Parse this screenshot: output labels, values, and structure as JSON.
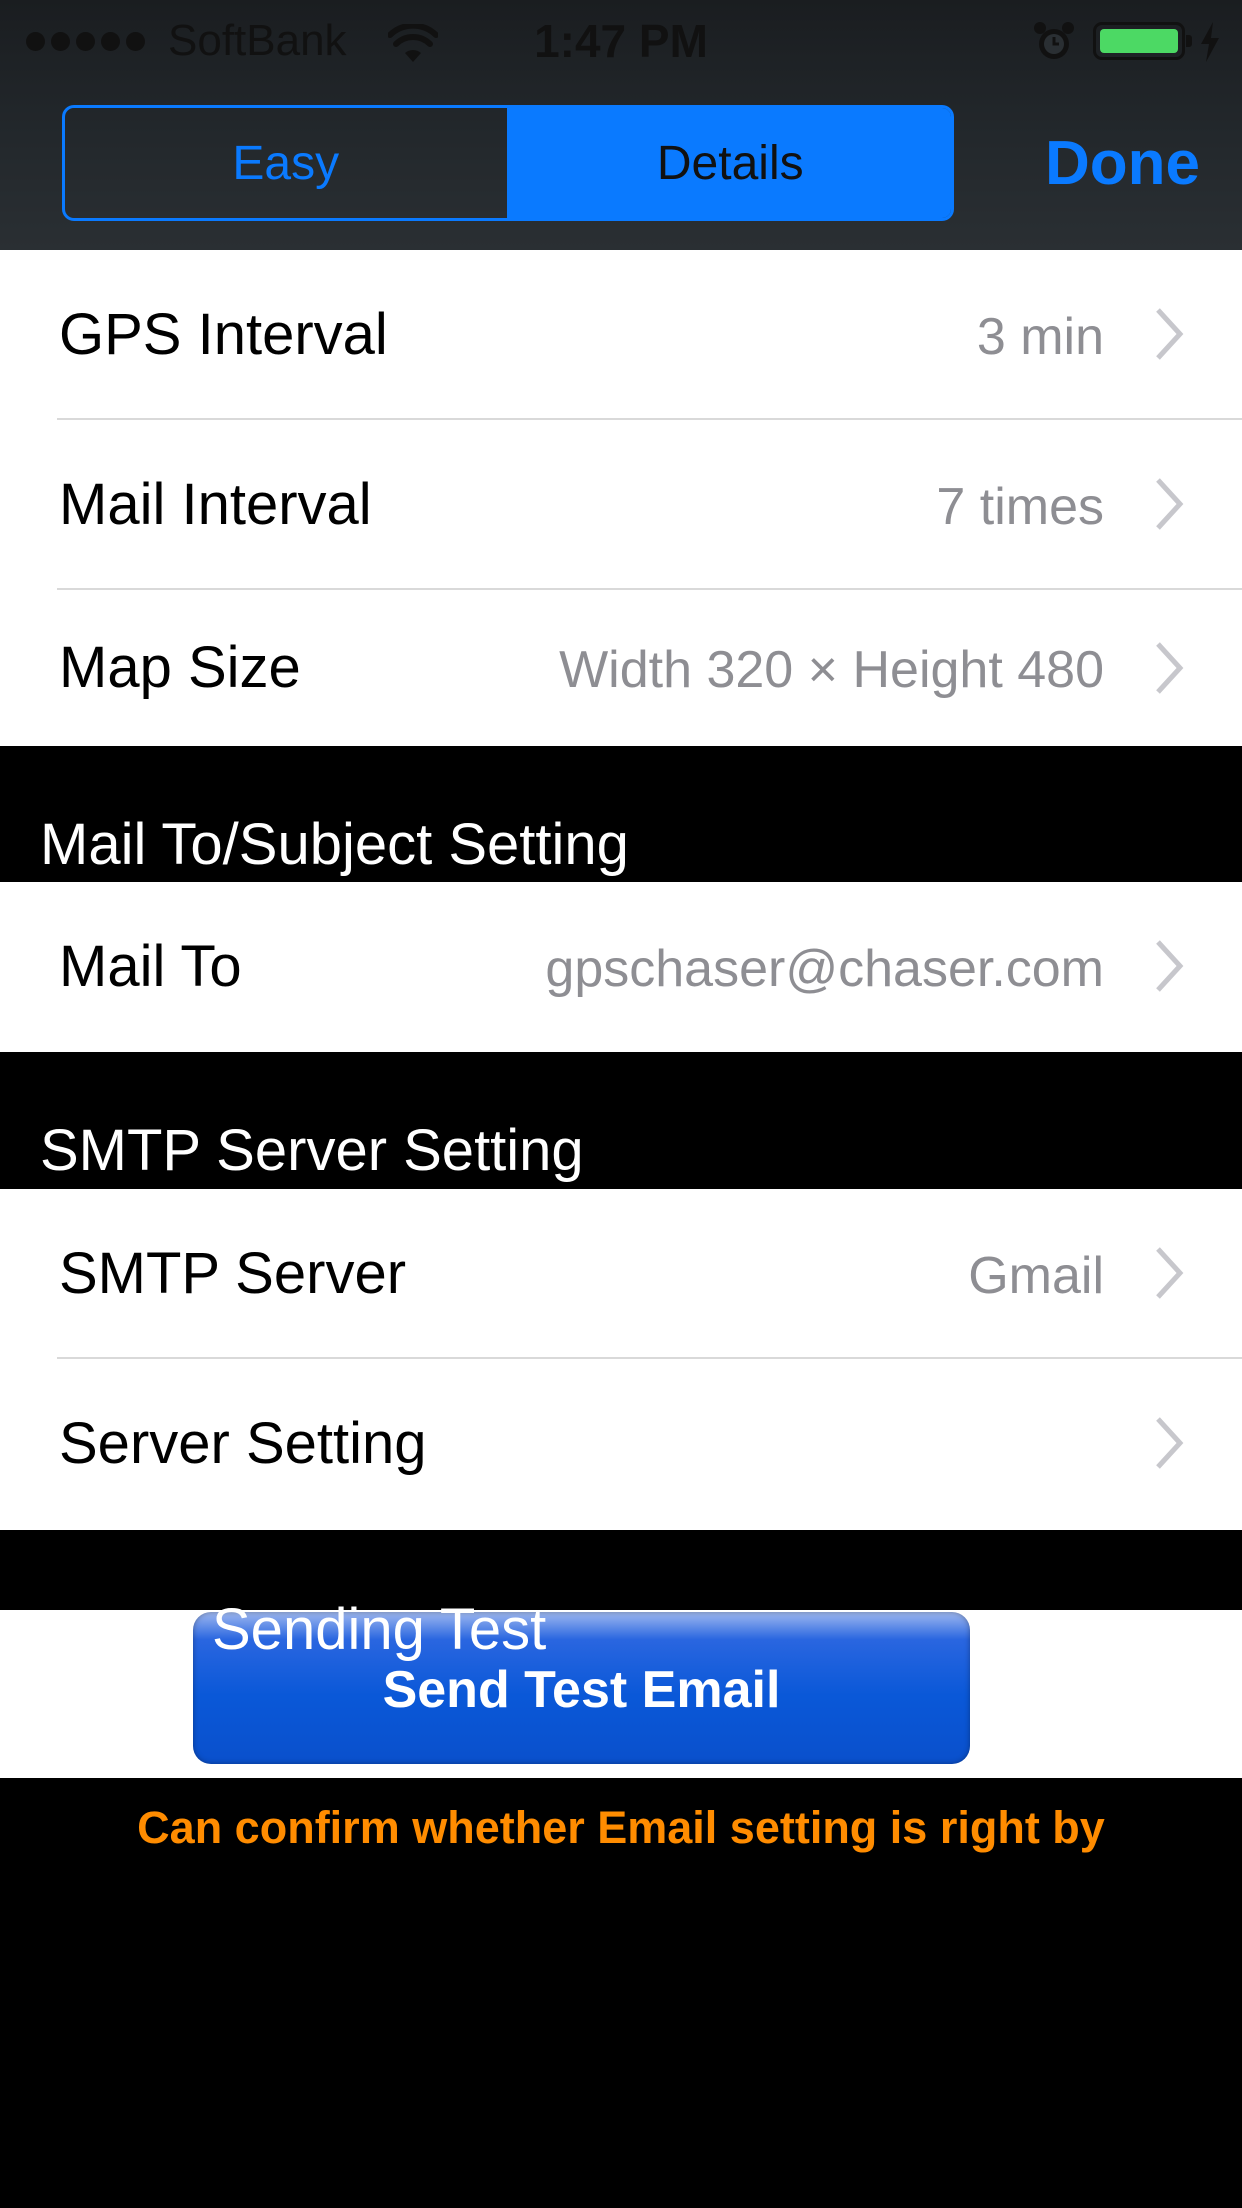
{
  "status_bar": {
    "carrier": "SoftBank",
    "time": "1:47 PM"
  },
  "nav": {
    "segments": [
      {
        "label": "Easy",
        "selected": false
      },
      {
        "label": "Details",
        "selected": true
      }
    ],
    "done_label": "Done"
  },
  "settings": {
    "gps_interval": {
      "label": "GPS Interval",
      "value": "3 min"
    },
    "mail_interval": {
      "label": "Mail Interval",
      "value": "7 times"
    },
    "map_size": {
      "label": "Map Size",
      "value": "Width 320 × Height 480"
    }
  },
  "sections": {
    "mail_to_subject": "Mail To/Subject Setting",
    "smtp": "SMTP Server Setting",
    "sending_test": "Sending Test"
  },
  "mail": {
    "mail_to": {
      "label": "Mail To",
      "value": "gpschaser@chaser.com"
    }
  },
  "smtp": {
    "server": {
      "label": "SMTP Server",
      "value": "Gmail"
    },
    "server_setting": {
      "label": "Server Setting"
    }
  },
  "test": {
    "button_label": "Send Test Email",
    "hint": "Can confirm whether Email setting is right by"
  },
  "colors": {
    "accent": "#0a7aff",
    "value_gray": "#8e8e93",
    "hint_orange": "#ff8c00",
    "battery_green": "#4cd964"
  }
}
